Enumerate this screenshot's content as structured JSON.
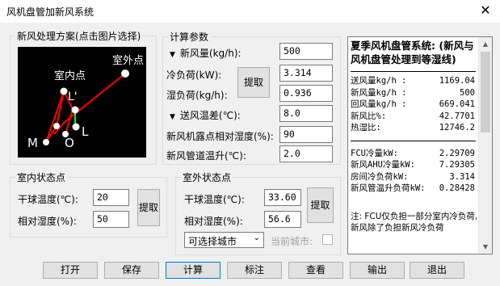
{
  "window": {
    "title": "风机盘管加新风系统",
    "close": "✕"
  },
  "scheme": {
    "legend": "新风处理方案(点击图片选择)",
    "labels": {
      "outdoor": "室外点",
      "indoor": "室内点",
      "L_prime": "L'",
      "M": "M",
      "O": "O",
      "L": "L"
    }
  },
  "calc": {
    "legend": "计算参数",
    "fresh_air": {
      "label": "新风量(kg/h):",
      "value": "500"
    },
    "cooling_load": {
      "label": "冷负荷(kW):",
      "value": "3.314"
    },
    "moisture_load": {
      "label": "湿负荷(kg/h):",
      "value": "0.936"
    },
    "extract": "提取",
    "supply_temp_diff": {
      "label": "送风温差(℃):",
      "value": "8.0"
    },
    "dew_point_rh": {
      "label": "新风机露点相对湿度(%):",
      "value": "90"
    },
    "duct_temp_rise": {
      "label": "新风管道温升(℃):",
      "value": "2.0"
    }
  },
  "indoor": {
    "legend": "室内状态点",
    "dry_bulb": {
      "label": "干球温度(℃):",
      "value": "20"
    },
    "rh": {
      "label": "相对湿度(%):",
      "value": "50"
    },
    "extract": "提取"
  },
  "outdoor": {
    "legend": "室外状态点",
    "dry_bulb": {
      "label": "干球温度(℃):",
      "value": "33.60"
    },
    "rh": {
      "label": "相对湿度(%):",
      "value": "56.6"
    },
    "extract": "提取",
    "city_select": "可选择城市",
    "current_city_label": "当前城市:"
  },
  "result": {
    "title": "夏季风机盘管系统: (新风与风机盘管处理到等湿线)",
    "rows1": [
      {
        "k": "送风量kg/h :",
        "v": "1169.04"
      },
      {
        "k": "新风量kg/h :",
        "v": "500"
      },
      {
        "k": "回风量kg/h :",
        "v": "669.041"
      },
      {
        "k": "新风比%:",
        "v": "42.7701"
      },
      {
        "k": "热湿比:",
        "v": "12746.2"
      }
    ],
    "rows2": [
      {
        "k": "FCU冷量kW:",
        "v": "2.29709"
      },
      {
        "k": "新风AHU冷量kW:",
        "v": "7.29305"
      },
      {
        "k": "房间冷负荷kW:",
        "v": "3.314"
      },
      {
        "k": "新风管温升负荷kW:",
        "v": "0.28428"
      }
    ],
    "note": "注: FCU仅负担一部分室内冷负荷,新风除了负担新风冷负荷"
  },
  "buttons": {
    "open": "打开",
    "save": "保存",
    "calculate": "计算",
    "annotate": "标注",
    "view": "查看",
    "output": "输出",
    "exit": "退出"
  },
  "icons": {
    "expand": "▼",
    "scroll_up": "▲",
    "scroll_down": "▼",
    "dropdown": "⌄"
  },
  "colors": {
    "diagram_bg": "#000000",
    "process_line": "#ff0000",
    "mix_line": "#00ff00",
    "point": "#ffffff"
  }
}
